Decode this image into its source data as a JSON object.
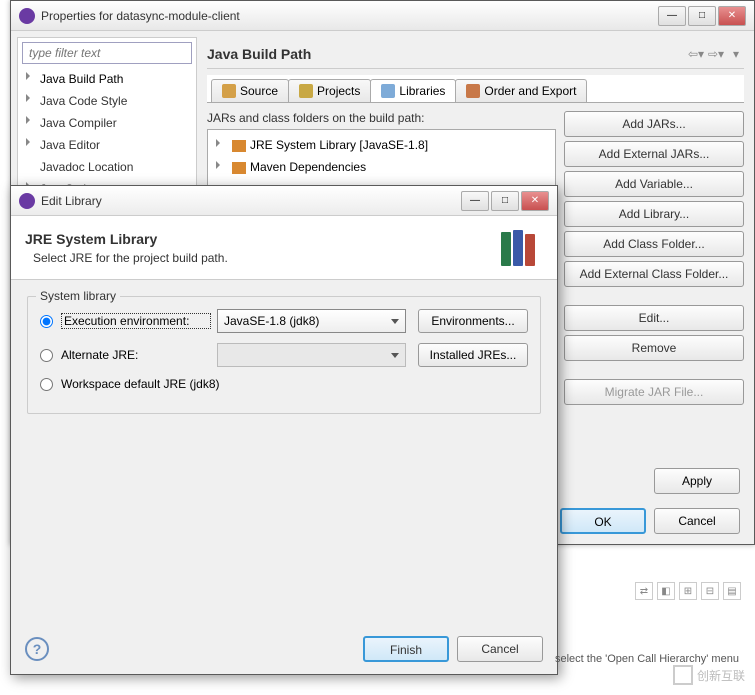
{
  "mainWindow": {
    "title": "Properties for datasync-module-client",
    "filterPlaceholder": "type filter text",
    "treeItems": [
      {
        "label": "Java Build Path",
        "selected": true,
        "arrow": true
      },
      {
        "label": "Java Code Style",
        "arrow": true
      },
      {
        "label": "Java Compiler",
        "arrow": true
      },
      {
        "label": "Java Editor",
        "arrow": true
      },
      {
        "label": "Javadoc Location",
        "arrow": false
      },
      {
        "label": "JavaScript",
        "arrow": true
      }
    ],
    "contentTitle": "Java Build Path",
    "tabs": [
      {
        "label": "Source",
        "icon": "src"
      },
      {
        "label": "Projects",
        "icon": "proj"
      },
      {
        "label": "Libraries",
        "icon": "lib",
        "active": true
      },
      {
        "label": "Order and Export",
        "icon": "ord"
      }
    ],
    "jarLabel": "JARs and class folders on the build path:",
    "jarItems": [
      "JRE System Library [JavaSE-1.8]",
      "Maven Dependencies"
    ],
    "buttons": {
      "addJars": "Add JARs...",
      "addExtJars": "Add External JARs...",
      "addVar": "Add Variable...",
      "addLib": "Add Library...",
      "addClass": "Add Class Folder...",
      "addExtClass": "Add External Class Folder...",
      "edit": "Edit...",
      "remove": "Remove",
      "migrate": "Migrate JAR File...",
      "apply": "Apply",
      "ok": "OK",
      "cancel": "Cancel"
    }
  },
  "modal": {
    "title": "Edit Library",
    "headerTitle": "JRE System Library",
    "headerDesc": "Select JRE for the project build path.",
    "groupLabel": "System library",
    "execEnvLabel": "Execution environment:",
    "execEnvValue": "JavaSE-1.8 (jdk8)",
    "envBtn": "Environments...",
    "altJreLabel": "Alternate JRE:",
    "installedBtn": "Installed JREs...",
    "workspaceLabel": "Workspace default JRE (jdk8)",
    "finish": "Finish",
    "cancel": "Cancel"
  },
  "hint": "select the 'Open Call Hierarchy' menu",
  "brand": "创新互联"
}
